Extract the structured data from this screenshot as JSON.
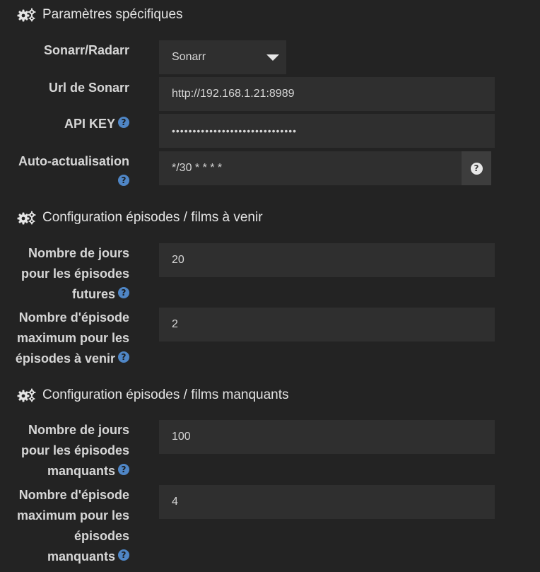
{
  "sections": {
    "specific": {
      "title": "Paramètres spécifiques",
      "icon": "cogs-icon"
    },
    "upcoming": {
      "title": "Configuration épisodes / films à venir",
      "icon": "cogs-icon"
    },
    "missing": {
      "title": "Configuration épisodes / films manquants",
      "icon": "cogs-icon"
    }
  },
  "fields": {
    "service": {
      "label": "Sonarr/Radarr",
      "value": "Sonarr"
    },
    "url": {
      "label": "Url de Sonarr",
      "value": "http://192.168.1.21:8989"
    },
    "api_key": {
      "label": "API KEY",
      "value": "••••••••••••••••••••••••••••••"
    },
    "auto_refresh": {
      "label_l1": "Auto-actualisation",
      "value": "*/30 * * * *",
      "addon": "?"
    },
    "upcoming_days": {
      "label_l1": "Nombre de jours",
      "label_l2": "pour les épisodes",
      "label_l3": "futures",
      "value": "20"
    },
    "upcoming_max": {
      "label_l1": "Nombre d'épisode",
      "label_l2": "maximum pour les",
      "label_l3": "épisodes à venir",
      "value": "2"
    },
    "missing_days": {
      "label_l1": "Nombre de jours",
      "label_l2": "pour les épisodes",
      "label_l3": "manquants",
      "value": "100"
    },
    "missing_max": {
      "label_l1": "Nombre d'épisode",
      "label_l2": "maximum pour les",
      "label_l3": "épisodes",
      "label_l4": "manquants",
      "value": "4"
    }
  },
  "help_glyph": "?",
  "colors": {
    "background": "#232323",
    "field": "#2f2f2f",
    "help": "#4f86c6"
  }
}
